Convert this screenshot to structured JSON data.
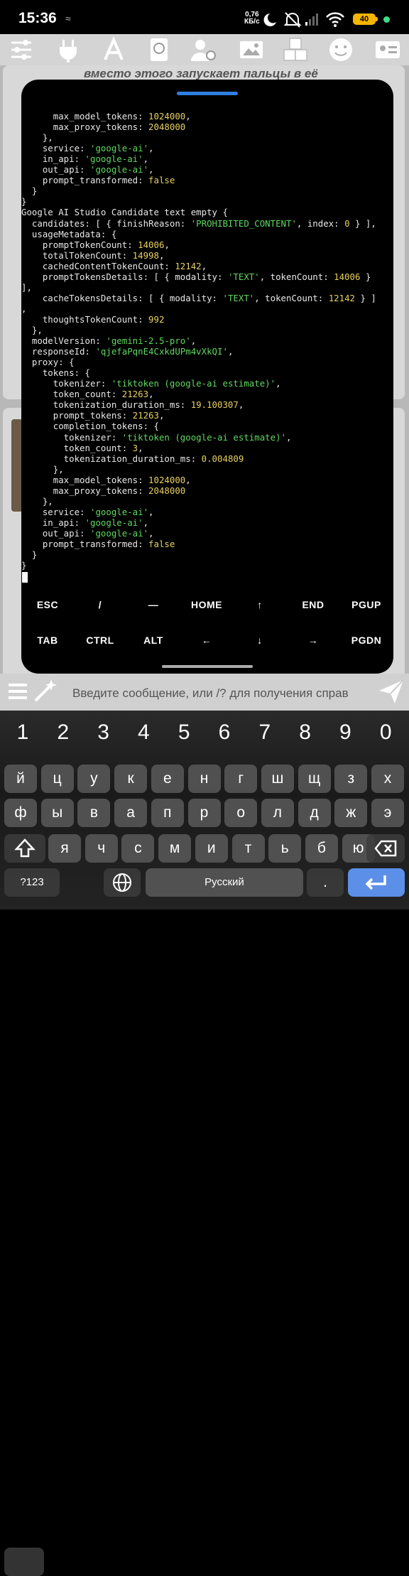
{
  "status": {
    "time": "15:36",
    "small_icon": "≈",
    "speed_value": "0,76",
    "speed_unit": "КБ/с",
    "battery": "40"
  },
  "toolbar_icons": [
    "sliders-icon",
    "plug-icon",
    "font-icon",
    "book-icon",
    "persona-icon",
    "image-icon",
    "extensions-icon",
    "smiley-icon",
    "user-card-icon"
  ],
  "background": {
    "text": "вместо этого запускает пальцы в её"
  },
  "terminal_lines": [
    {
      "t": [
        [
          "k",
          "      max_model_tokens: "
        ],
        [
          "n",
          "1024000"
        ],
        [
          "k",
          ","
        ]
      ]
    },
    {
      "t": [
        [
          "k",
          "      max_proxy_tokens: "
        ],
        [
          "n",
          "2048000"
        ]
      ]
    },
    {
      "t": [
        [
          "k",
          "    },"
        ]
      ]
    },
    {
      "t": [
        [
          "k",
          "    service: "
        ],
        [
          "s",
          "'google-ai'"
        ],
        [
          "k",
          ","
        ]
      ]
    },
    {
      "t": [
        [
          "k",
          "    in_api: "
        ],
        [
          "s",
          "'google-ai'"
        ],
        [
          "k",
          ","
        ]
      ]
    },
    {
      "t": [
        [
          "k",
          "    out_api: "
        ],
        [
          "s",
          "'google-ai'"
        ],
        [
          "k",
          ","
        ]
      ]
    },
    {
      "t": [
        [
          "k",
          "    prompt_transformed: "
        ],
        [
          "n",
          "false"
        ]
      ]
    },
    {
      "t": [
        [
          "k",
          "  }"
        ]
      ]
    },
    {
      "t": [
        [
          "k",
          "}"
        ]
      ]
    },
    {
      "t": [
        [
          "k",
          "Google AI Studio Candidate text empty {"
        ]
      ]
    },
    {
      "t": [
        [
          "k",
          "  candidates: [ { finishReason: "
        ],
        [
          "s",
          "'PROHIBITED_CONTENT'"
        ],
        [
          "k",
          ", index: "
        ],
        [
          "n",
          "0"
        ],
        [
          "k",
          " } ],"
        ]
      ]
    },
    {
      "t": [
        [
          "k",
          "  usageMetadata: {"
        ]
      ]
    },
    {
      "t": [
        [
          "k",
          "    promptTokenCount: "
        ],
        [
          "n",
          "14006"
        ],
        [
          "k",
          ","
        ]
      ]
    },
    {
      "t": [
        [
          "k",
          "    totalTokenCount: "
        ],
        [
          "n",
          "14998"
        ],
        [
          "k",
          ","
        ]
      ]
    },
    {
      "t": [
        [
          "k",
          "    cachedContentTokenCount: "
        ],
        [
          "n",
          "12142"
        ],
        [
          "k",
          ","
        ]
      ]
    },
    {
      "t": [
        [
          "k",
          "    promptTokensDetails: [ { modality: "
        ],
        [
          "s",
          "'TEXT'"
        ],
        [
          "k",
          ", tokenCount: "
        ],
        [
          "n",
          "14006"
        ],
        [
          "k",
          " }"
        ]
      ]
    },
    {
      "t": [
        [
          "k",
          "],"
        ]
      ]
    },
    {
      "t": [
        [
          "k",
          "    cacheTokensDetails: [ { modality: "
        ],
        [
          "s",
          "'TEXT'"
        ],
        [
          "k",
          ", tokenCount: "
        ],
        [
          "n",
          "12142"
        ],
        [
          "k",
          " } ]"
        ]
      ]
    },
    {
      "t": [
        [
          "k",
          ","
        ]
      ]
    },
    {
      "t": [
        [
          "k",
          "    thoughtsTokenCount: "
        ],
        [
          "n",
          "992"
        ]
      ]
    },
    {
      "t": [
        [
          "k",
          "  },"
        ]
      ]
    },
    {
      "t": [
        [
          "k",
          "  modelVersion: "
        ],
        [
          "s",
          "'gemini-2.5-pro'"
        ],
        [
          "k",
          ","
        ]
      ]
    },
    {
      "t": [
        [
          "k",
          "  responseId: "
        ],
        [
          "s",
          "'qjefaPqnE4CxkdUPm4vXkQI'"
        ],
        [
          "k",
          ","
        ]
      ]
    },
    {
      "t": [
        [
          "k",
          "  proxy: {"
        ]
      ]
    },
    {
      "t": [
        [
          "k",
          "    tokens: {"
        ]
      ]
    },
    {
      "t": [
        [
          "k",
          "      tokenizer: "
        ],
        [
          "s",
          "'tiktoken (google-ai estimate)'"
        ],
        [
          "k",
          ","
        ]
      ]
    },
    {
      "t": [
        [
          "k",
          "      token_count: "
        ],
        [
          "n",
          "21263"
        ],
        [
          "k",
          ","
        ]
      ]
    },
    {
      "t": [
        [
          "k",
          "      tokenization_duration_ms: "
        ],
        [
          "n",
          "19.100307"
        ],
        [
          "k",
          ","
        ]
      ]
    },
    {
      "t": [
        [
          "k",
          "      prompt_tokens: "
        ],
        [
          "n",
          "21263"
        ],
        [
          "k",
          ","
        ]
      ]
    },
    {
      "t": [
        [
          "k",
          "      completion_tokens: {"
        ]
      ]
    },
    {
      "t": [
        [
          "k",
          "        tokenizer: "
        ],
        [
          "s",
          "'tiktoken (google-ai estimate)'"
        ],
        [
          "k",
          ","
        ]
      ]
    },
    {
      "t": [
        [
          "k",
          "        token_count: "
        ],
        [
          "n",
          "3"
        ],
        [
          "k",
          ","
        ]
      ]
    },
    {
      "t": [
        [
          "k",
          "        tokenization_duration_ms: "
        ],
        [
          "n",
          "0.004809"
        ]
      ]
    },
    {
      "t": [
        [
          "k",
          "      },"
        ]
      ]
    },
    {
      "t": [
        [
          "k",
          "      max_model_tokens: "
        ],
        [
          "n",
          "1024000"
        ],
        [
          "k",
          ","
        ]
      ]
    },
    {
      "t": [
        [
          "k",
          "      max_proxy_tokens: "
        ],
        [
          "n",
          "2048000"
        ]
      ]
    },
    {
      "t": [
        [
          "k",
          "    },"
        ]
      ]
    },
    {
      "t": [
        [
          "k",
          "    service: "
        ],
        [
          "s",
          "'google-ai'"
        ],
        [
          "k",
          ","
        ]
      ]
    },
    {
      "t": [
        [
          "k",
          "    in_api: "
        ],
        [
          "s",
          "'google-ai'"
        ],
        [
          "k",
          ","
        ]
      ]
    },
    {
      "t": [
        [
          "k",
          "    out_api: "
        ],
        [
          "s",
          "'google-ai'"
        ],
        [
          "k",
          ","
        ]
      ]
    },
    {
      "t": [
        [
          "k",
          "    prompt_transformed: "
        ],
        [
          "n",
          "false"
        ]
      ]
    },
    {
      "t": [
        [
          "k",
          "  }"
        ]
      ]
    },
    {
      "t": [
        [
          "k",
          "}"
        ]
      ]
    }
  ],
  "extra_keys": {
    "row1": [
      "ESC",
      "/",
      "—",
      "HOME",
      "↑",
      "END",
      "PGUP"
    ],
    "row2": [
      "TAB",
      "CTRL",
      "ALT",
      "←",
      "↓",
      "→",
      "PGDN"
    ]
  },
  "composer": {
    "placeholder": "Введите сообщение, или /? для получения справ"
  },
  "keyboard": {
    "numbers": [
      "1",
      "2",
      "3",
      "4",
      "5",
      "6",
      "7",
      "8",
      "9",
      "0"
    ],
    "row1": [
      "й",
      "ц",
      "у",
      "к",
      "е",
      "н",
      "г",
      "ш",
      "щ",
      "з",
      "х"
    ],
    "row2": [
      "ф",
      "ы",
      "в",
      "а",
      "п",
      "р",
      "о",
      "л",
      "д",
      "ж",
      "э"
    ],
    "row3": [
      "я",
      "ч",
      "с",
      "м",
      "и",
      "т",
      "ь",
      "б",
      "ю"
    ],
    "mode_label": "?123",
    "space_label": "Русский",
    "period_label": "."
  },
  "colors": {
    "string": "#5fd75f",
    "number": "#e8d060",
    "accent": "#2f7fe0",
    "enter": "#5b8fe8"
  }
}
